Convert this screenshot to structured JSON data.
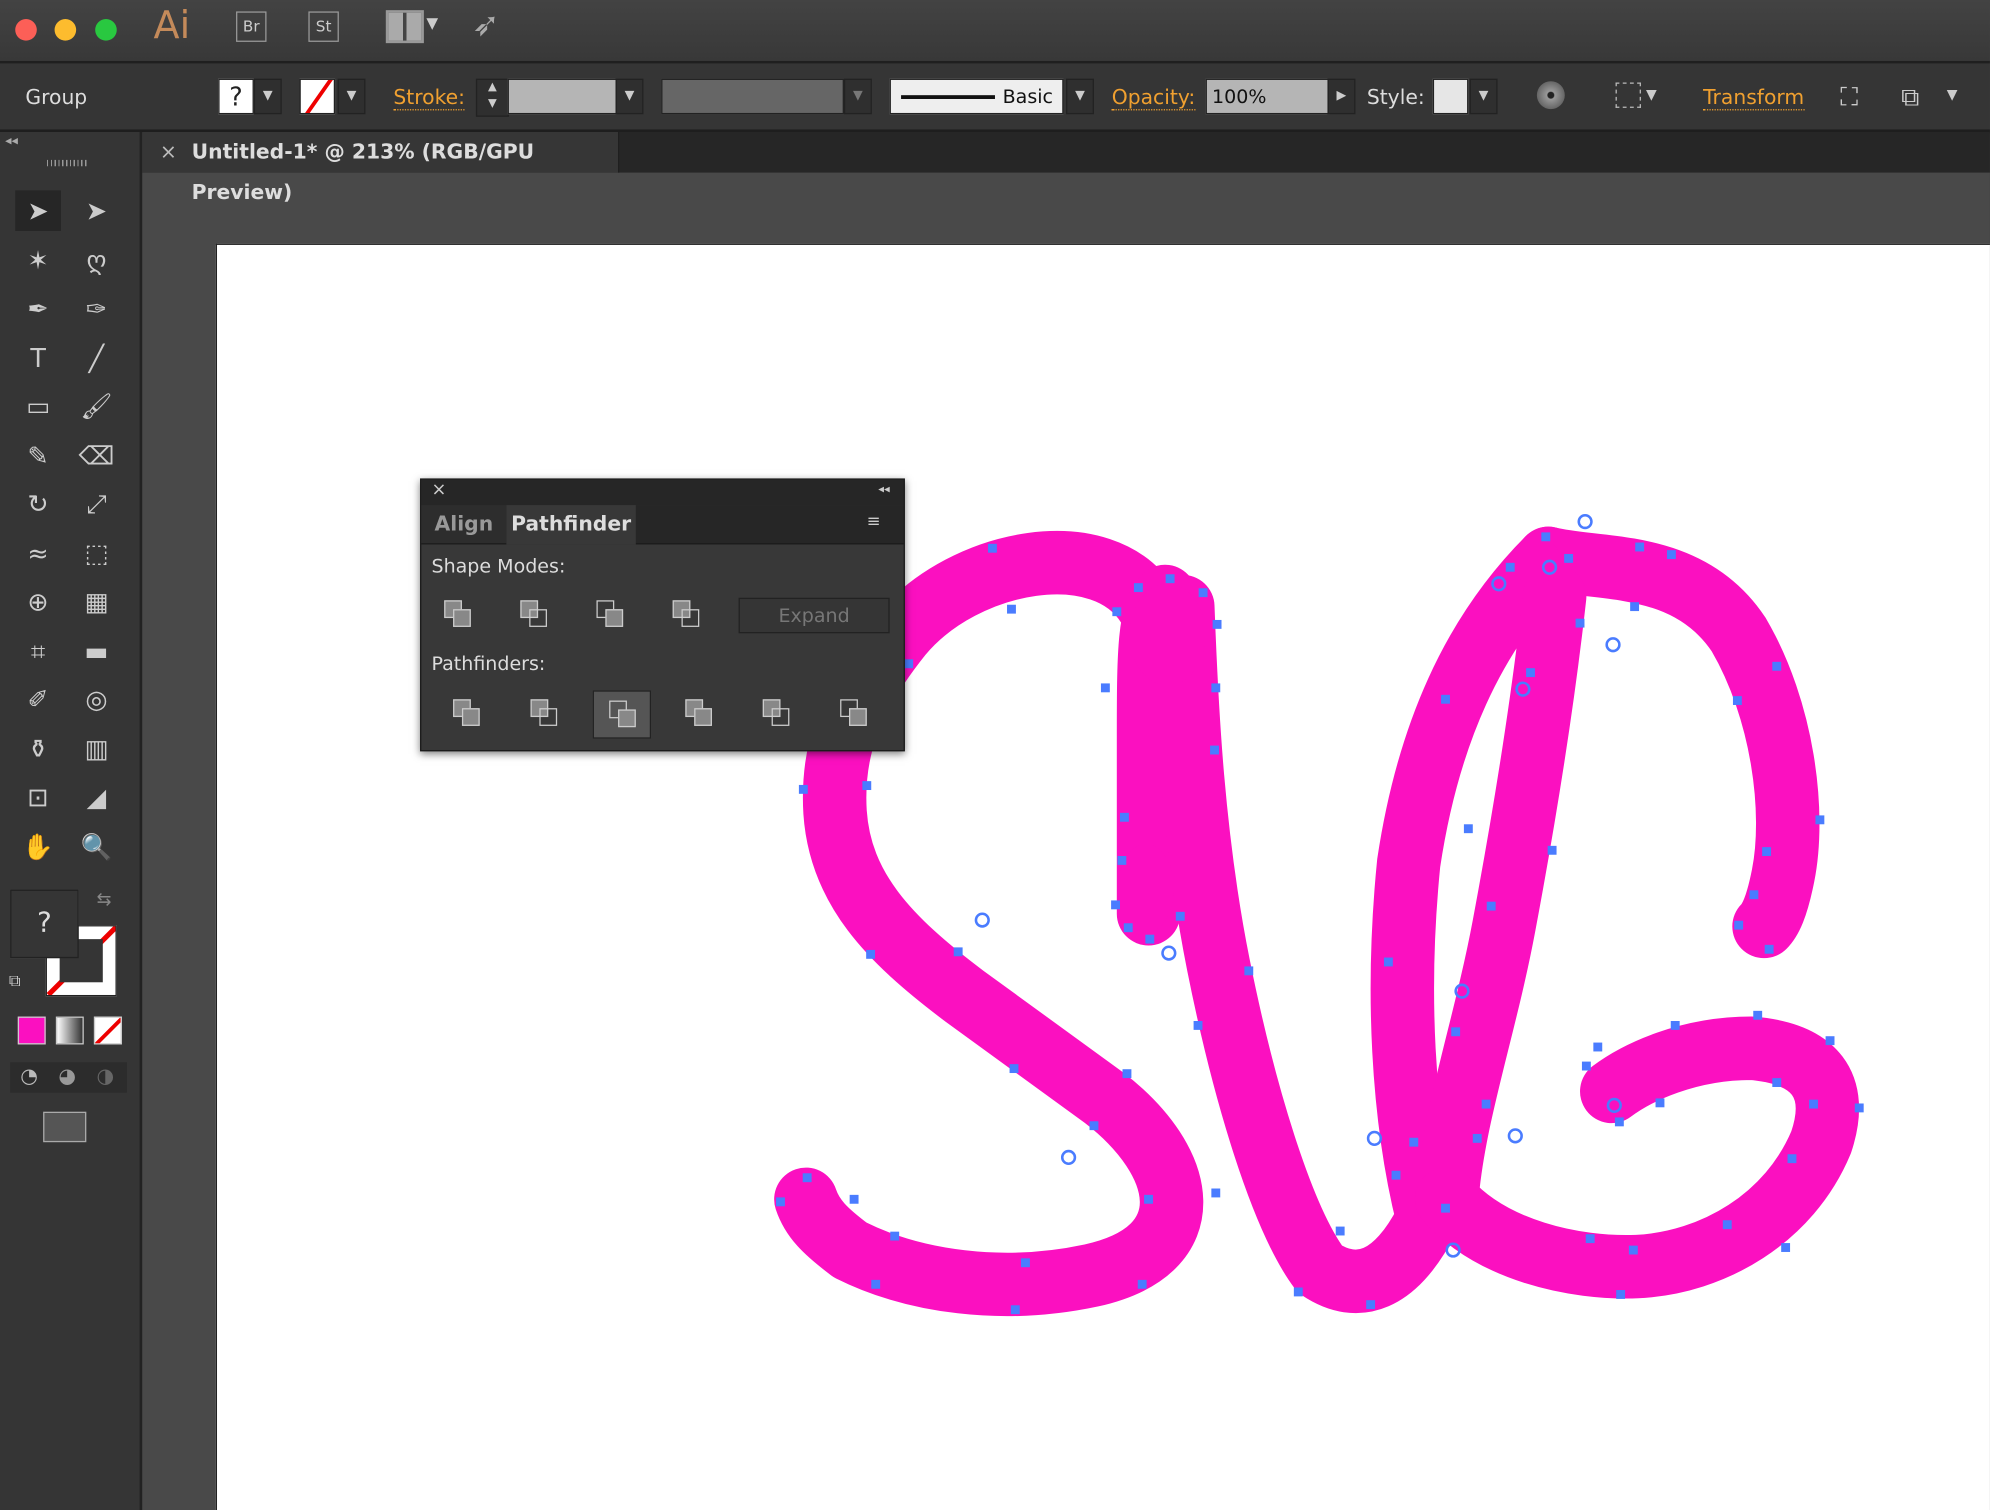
{
  "app": {
    "logo": "Ai",
    "bridge": "Br",
    "stock": "St"
  },
  "control_bar": {
    "selection_type": "Group",
    "fill_value": "?",
    "stroke_label": "Stroke:",
    "brush_style": "Basic",
    "opacity_label": "Opacity:",
    "opacity_value": "100%",
    "style_label": "Style:",
    "transform_label": "Transform"
  },
  "document_tab": {
    "close": "×",
    "title": "Untitled-1* @ 213% (RGB/GPU Preview)"
  },
  "toolbar": {
    "fill_unknown": "?"
  },
  "pathfinder_panel": {
    "close": "×",
    "collapse": "◂◂",
    "tabs": [
      {
        "label": "Align",
        "active": false
      },
      {
        "label": "Pathfinder",
        "active": true
      }
    ],
    "shape_modes_label": "Shape Modes:",
    "shape_modes": [
      "unite",
      "minus-front",
      "intersect",
      "exclude"
    ],
    "expand_label": "Expand",
    "pathfinders_label": "Pathfinders:",
    "pathfinders": [
      "divide",
      "trim",
      "merge",
      "crop",
      "outline",
      "minus-back"
    ],
    "active_pathfinder": "merge"
  },
  "colors": {
    "artwork_fill": "#fb10c0",
    "anchor": "#4a7cff",
    "accent": "#f0a030"
  }
}
